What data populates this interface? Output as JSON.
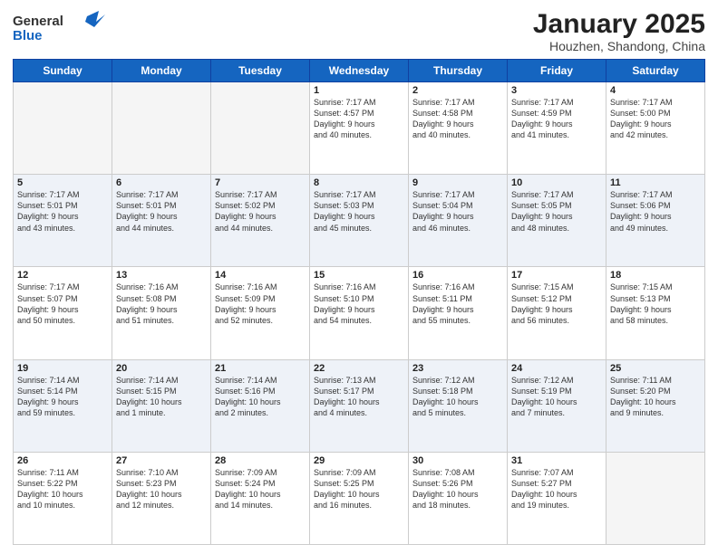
{
  "header": {
    "logo_line1": "General",
    "logo_line2": "Blue",
    "month": "January 2025",
    "location": "Houzhen, Shandong, China"
  },
  "days_of_week": [
    "Sunday",
    "Monday",
    "Tuesday",
    "Wednesday",
    "Thursday",
    "Friday",
    "Saturday"
  ],
  "weeks": [
    [
      {
        "day": "",
        "info": ""
      },
      {
        "day": "",
        "info": ""
      },
      {
        "day": "",
        "info": ""
      },
      {
        "day": "1",
        "info": "Sunrise: 7:17 AM\nSunset: 4:57 PM\nDaylight: 9 hours\nand 40 minutes."
      },
      {
        "day": "2",
        "info": "Sunrise: 7:17 AM\nSunset: 4:58 PM\nDaylight: 9 hours\nand 40 minutes."
      },
      {
        "day": "3",
        "info": "Sunrise: 7:17 AM\nSunset: 4:59 PM\nDaylight: 9 hours\nand 41 minutes."
      },
      {
        "day": "4",
        "info": "Sunrise: 7:17 AM\nSunset: 5:00 PM\nDaylight: 9 hours\nand 42 minutes."
      }
    ],
    [
      {
        "day": "5",
        "info": "Sunrise: 7:17 AM\nSunset: 5:01 PM\nDaylight: 9 hours\nand 43 minutes."
      },
      {
        "day": "6",
        "info": "Sunrise: 7:17 AM\nSunset: 5:01 PM\nDaylight: 9 hours\nand 44 minutes."
      },
      {
        "day": "7",
        "info": "Sunrise: 7:17 AM\nSunset: 5:02 PM\nDaylight: 9 hours\nand 44 minutes."
      },
      {
        "day": "8",
        "info": "Sunrise: 7:17 AM\nSunset: 5:03 PM\nDaylight: 9 hours\nand 45 minutes."
      },
      {
        "day": "9",
        "info": "Sunrise: 7:17 AM\nSunset: 5:04 PM\nDaylight: 9 hours\nand 46 minutes."
      },
      {
        "day": "10",
        "info": "Sunrise: 7:17 AM\nSunset: 5:05 PM\nDaylight: 9 hours\nand 48 minutes."
      },
      {
        "day": "11",
        "info": "Sunrise: 7:17 AM\nSunset: 5:06 PM\nDaylight: 9 hours\nand 49 minutes."
      }
    ],
    [
      {
        "day": "12",
        "info": "Sunrise: 7:17 AM\nSunset: 5:07 PM\nDaylight: 9 hours\nand 50 minutes."
      },
      {
        "day": "13",
        "info": "Sunrise: 7:16 AM\nSunset: 5:08 PM\nDaylight: 9 hours\nand 51 minutes."
      },
      {
        "day": "14",
        "info": "Sunrise: 7:16 AM\nSunset: 5:09 PM\nDaylight: 9 hours\nand 52 minutes."
      },
      {
        "day": "15",
        "info": "Sunrise: 7:16 AM\nSunset: 5:10 PM\nDaylight: 9 hours\nand 54 minutes."
      },
      {
        "day": "16",
        "info": "Sunrise: 7:16 AM\nSunset: 5:11 PM\nDaylight: 9 hours\nand 55 minutes."
      },
      {
        "day": "17",
        "info": "Sunrise: 7:15 AM\nSunset: 5:12 PM\nDaylight: 9 hours\nand 56 minutes."
      },
      {
        "day": "18",
        "info": "Sunrise: 7:15 AM\nSunset: 5:13 PM\nDaylight: 9 hours\nand 58 minutes."
      }
    ],
    [
      {
        "day": "19",
        "info": "Sunrise: 7:14 AM\nSunset: 5:14 PM\nDaylight: 9 hours\nand 59 minutes."
      },
      {
        "day": "20",
        "info": "Sunrise: 7:14 AM\nSunset: 5:15 PM\nDaylight: 10 hours\nand 1 minute."
      },
      {
        "day": "21",
        "info": "Sunrise: 7:14 AM\nSunset: 5:16 PM\nDaylight: 10 hours\nand 2 minutes."
      },
      {
        "day": "22",
        "info": "Sunrise: 7:13 AM\nSunset: 5:17 PM\nDaylight: 10 hours\nand 4 minutes."
      },
      {
        "day": "23",
        "info": "Sunrise: 7:12 AM\nSunset: 5:18 PM\nDaylight: 10 hours\nand 5 minutes."
      },
      {
        "day": "24",
        "info": "Sunrise: 7:12 AM\nSunset: 5:19 PM\nDaylight: 10 hours\nand 7 minutes."
      },
      {
        "day": "25",
        "info": "Sunrise: 7:11 AM\nSunset: 5:20 PM\nDaylight: 10 hours\nand 9 minutes."
      }
    ],
    [
      {
        "day": "26",
        "info": "Sunrise: 7:11 AM\nSunset: 5:22 PM\nDaylight: 10 hours\nand 10 minutes."
      },
      {
        "day": "27",
        "info": "Sunrise: 7:10 AM\nSunset: 5:23 PM\nDaylight: 10 hours\nand 12 minutes."
      },
      {
        "day": "28",
        "info": "Sunrise: 7:09 AM\nSunset: 5:24 PM\nDaylight: 10 hours\nand 14 minutes."
      },
      {
        "day": "29",
        "info": "Sunrise: 7:09 AM\nSunset: 5:25 PM\nDaylight: 10 hours\nand 16 minutes."
      },
      {
        "day": "30",
        "info": "Sunrise: 7:08 AM\nSunset: 5:26 PM\nDaylight: 10 hours\nand 18 minutes."
      },
      {
        "day": "31",
        "info": "Sunrise: 7:07 AM\nSunset: 5:27 PM\nDaylight: 10 hours\nand 19 minutes."
      },
      {
        "day": "",
        "info": ""
      }
    ]
  ]
}
